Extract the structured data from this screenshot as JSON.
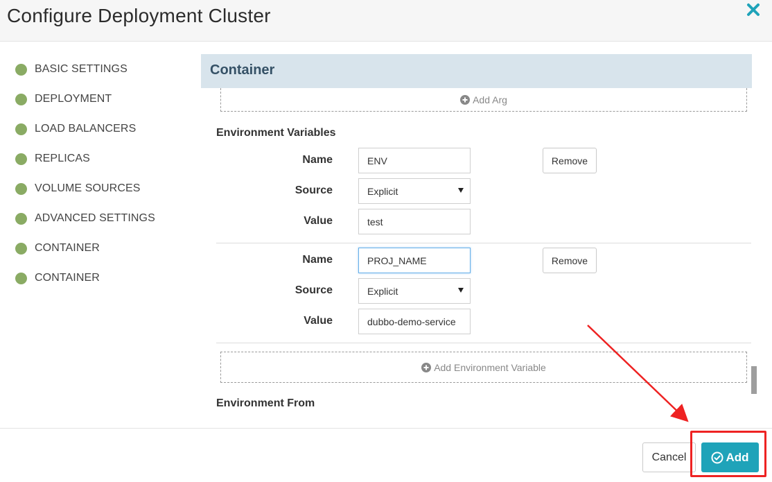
{
  "dialog": {
    "title": "Configure Deployment Cluster"
  },
  "sidebar": {
    "items": [
      {
        "label": "BASIC SETTINGS"
      },
      {
        "label": "DEPLOYMENT"
      },
      {
        "label": "LOAD BALANCERS"
      },
      {
        "label": "REPLICAS"
      },
      {
        "label": "VOLUME SOURCES"
      },
      {
        "label": "ADVANCED SETTINGS"
      },
      {
        "label": "CONTAINER"
      },
      {
        "label": "CONTAINER"
      }
    ],
    "status_color": "#8aab64"
  },
  "container": {
    "title": "Container",
    "add_arg_label": "Add Arg",
    "env_heading": "Environment Variables",
    "env_vars": [
      {
        "name_label": "Name",
        "name_value": "ENV",
        "source_label": "Source",
        "source_value": "Explicit",
        "value_label": "Value",
        "value": "test",
        "remove_label": "Remove"
      },
      {
        "name_label": "Name",
        "name_value": "PROJ_NAME",
        "source_label": "Source",
        "source_value": "Explicit",
        "value_label": "Value",
        "value": "dubbo-demo-service",
        "remove_label": "Remove"
      }
    ],
    "add_env_label": "Add Environment Variable",
    "env_from_heading": "Environment From"
  },
  "footer": {
    "cancel_label": "Cancel",
    "add_label": "Add",
    "accent_color": "#1fa3b9"
  },
  "annotation": {
    "color": "#ee2222"
  }
}
